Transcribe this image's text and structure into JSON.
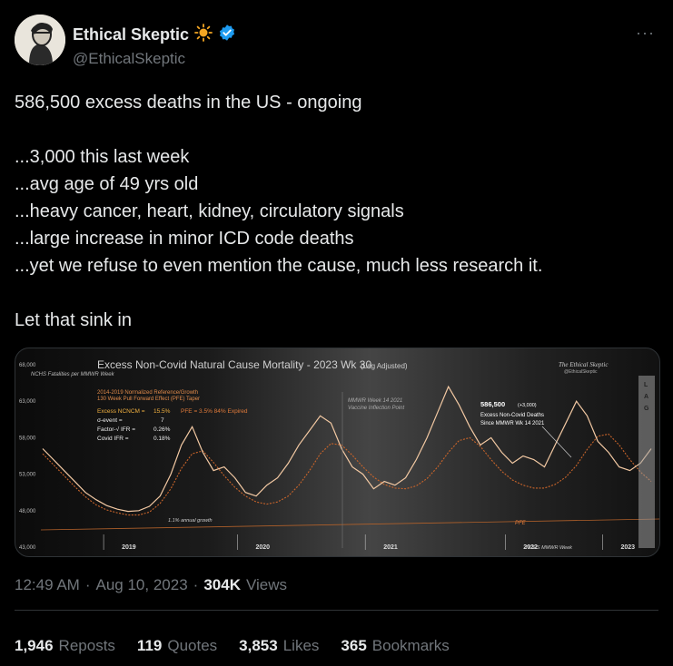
{
  "author": {
    "display_name": "Ethical Skeptic",
    "handle": "@EthicalSkeptic"
  },
  "icons": {
    "sun": "sun-emoji-icon",
    "verified": "verified-badge-icon",
    "more": "more-icon"
  },
  "colors": {
    "verified": "#1d9bf0",
    "accent_orange": "#f08a3a"
  },
  "tweet": {
    "lines": [
      "586,500 excess deaths in the US - ongoing",
      "",
      "...3,000 this last week",
      "...avg age of 49 yrs old",
      "...heavy cancer, heart, kidney, circulatory signals",
      "...large increase in minor ICD code deaths",
      "...yet we refuse to even mention the cause, much less research it.",
      "",
      "Let that sink in"
    ]
  },
  "meta": {
    "time": "12:49 AM",
    "date": "Aug 10, 2023",
    "views": "304K",
    "views_label": "Views"
  },
  "stats": [
    {
      "num": "1,946",
      "label": "Reposts"
    },
    {
      "num": "119",
      "label": "Quotes"
    },
    {
      "num": "3,853",
      "label": "Likes"
    },
    {
      "num": "365",
      "label": "Bookmarks"
    }
  ],
  "chart_data": {
    "type": "line",
    "title": "Excess Non-Covid Natural Cause Mortality - 2023 Wk 30",
    "title_suffix": "(Lag Adjusted)",
    "ylabel": "NCHS Fatalities per MMWR Week",
    "yticks": [
      "68,000",
      "63,000",
      "58,000",
      "53,000",
      "48,000",
      "43,000"
    ],
    "ylim": [
      43000,
      68000
    ],
    "xticks": [
      "2019",
      "2020",
      "2021",
      "2022",
      "2023"
    ],
    "xnote": "NCHS MMWR Week",
    "legend_lines": [
      "2014-2019 Normalized Reference/Growth",
      "130 Week Pull Forward Effect (PFE) Taper"
    ],
    "stats_block": [
      {
        "label": "Excess NCNCM =",
        "value": "15.5%"
      },
      {
        "label": "σ-event =",
        "value": "7"
      },
      {
        "label": "Factor-√ IFR =",
        "value": "0.26%"
      },
      {
        "label": "Covid IFR =",
        "value": "0.18%"
      }
    ],
    "pfe_note": "PFE = 3.5%  84% Expired",
    "vaccine_marker": [
      "MMWR Week 14 2021",
      "Vaccine Inflection Point"
    ],
    "callout": {
      "value": "586,500",
      "delta": "(+3,000)",
      "lines": [
        "Excess Non-Covid Deaths",
        "Since MMWR Wk 14 2021"
      ]
    },
    "growth_note": "1.1% annual growth",
    "pfe_label": "PFE",
    "lag_label": "LAG",
    "watermark": [
      "The Ethical Skeptic",
      "@EthicalSkeptic"
    ],
    "series": [
      {
        "name": "Actual",
        "values": [
          56500,
          55000,
          53500,
          52000,
          50500,
          49500,
          48700,
          48200,
          47900,
          48000,
          48600,
          50000,
          53000,
          57000,
          59500,
          56000,
          53500,
          54000,
          52500,
          50500,
          50000,
          51500,
          52500,
          54500,
          57000,
          59000,
          61000,
          60000,
          56500,
          54000,
          53000,
          51000,
          52000,
          51500,
          52500,
          55000,
          58000,
          61500,
          65000,
          62500,
          59500,
          57000,
          58000,
          56000,
          54500,
          55500,
          55000,
          54000,
          57000,
          60000,
          63000,
          61000,
          57500,
          56000,
          54000,
          53500,
          54500,
          56500
        ]
      },
      {
        "name": "Normalized Reference",
        "values": [
          55800,
          54300,
          52800,
          51300,
          49900,
          48800,
          48100,
          47700,
          47400,
          47400,
          47800,
          49000,
          51000,
          53800,
          55800,
          56200,
          54600,
          52800,
          51200,
          50000,
          49200,
          48900,
          49200,
          50000,
          51500,
          53500,
          55800,
          57200,
          57000,
          55600,
          54000,
          52600,
          51600,
          51100,
          51000,
          51400,
          52400,
          54000,
          56000,
          57600,
          58000,
          56800,
          55000,
          53400,
          52200,
          51500,
          51100,
          51100,
          51600,
          52600,
          54200,
          56400,
          58200,
          58500,
          57000,
          55000,
          53300,
          52000
        ]
      }
    ]
  }
}
